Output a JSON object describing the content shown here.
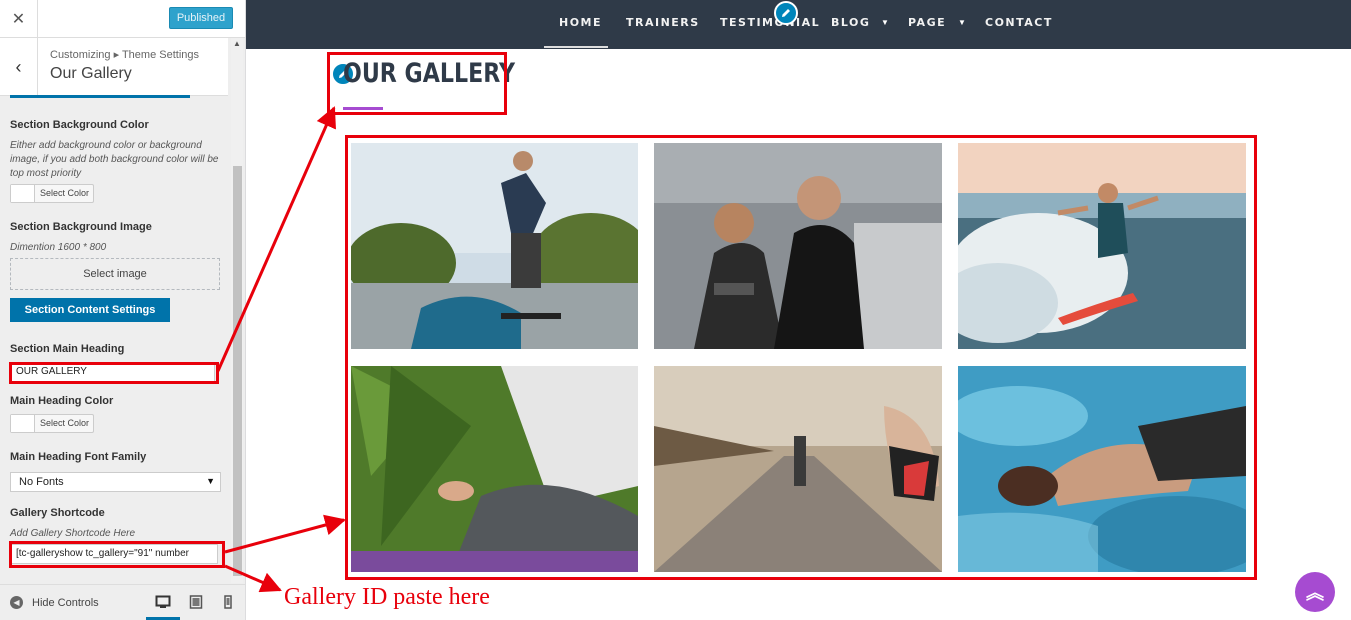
{
  "customizer": {
    "close_icon": "close-icon",
    "published_label": "Published",
    "breadcrumb": "Customizing ▸ Theme Settings",
    "section_title": "Our Gallery",
    "bg_color": {
      "label": "Section Background Color",
      "description": "Either add background color or background image, if you add both background color will be top most priority",
      "button": "Select Color"
    },
    "bg_image": {
      "label": "Section Background Image",
      "description": "Dimention 1600 * 800",
      "button": "Select image"
    },
    "content_settings_button": "Section Content Settings",
    "main_heading": {
      "label": "Section Main Heading",
      "value": "OUR GALLERY"
    },
    "heading_color": {
      "label": "Main Heading Color",
      "button": "Select Color"
    },
    "heading_font": {
      "label": "Main Heading Font Family",
      "selected": "No Fonts"
    },
    "shortcode": {
      "label": "Gallery Shortcode",
      "description": "Add Gallery Shortcode Here",
      "value": "[tc-galleryshow tc_gallery=\"91\" number"
    },
    "hide_controls": "Hide Controls",
    "devices": [
      "desktop-icon",
      "tablet-icon",
      "mobile-icon"
    ],
    "accent": "#0073aa"
  },
  "nav": {
    "items": [
      "HOME",
      "TRAINERS",
      "TESTIMONIAL",
      "BLOG",
      "PAGE",
      "CONTACT"
    ],
    "active": "HOME",
    "background": "#2f3a48"
  },
  "gallery": {
    "heading": "OUR GALLERY",
    "accent": "#a64bd1",
    "photos": [
      "skateboarder",
      "gym-trainer",
      "surfer",
      "yoga-meditation",
      "runner",
      "swimmer"
    ]
  },
  "annotation": {
    "text": "Gallery ID paste here",
    "color": "#e8000b"
  }
}
